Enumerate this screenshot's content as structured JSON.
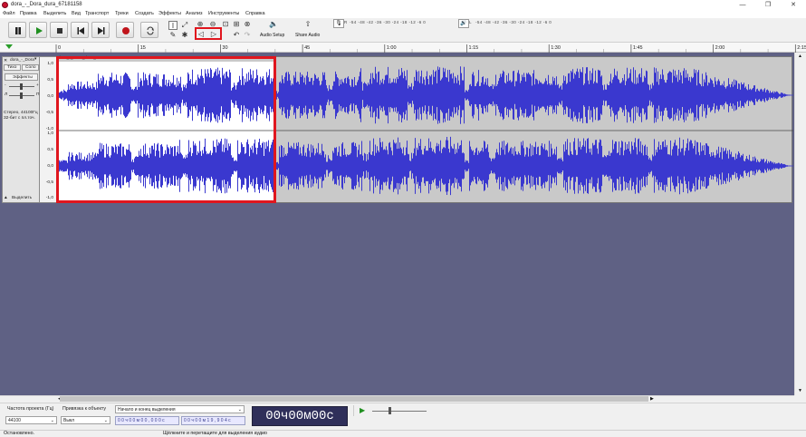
{
  "window": {
    "title": "dora_-_Dora_dura_67181158",
    "minimize": "—",
    "maximize": "❐",
    "close": "✕"
  },
  "menu": [
    "Файл",
    "Правка",
    "Выделить",
    "Вид",
    "Транспорт",
    "Треки",
    "Создать",
    "Эффекты",
    "Анализ",
    "Инструменты",
    "Справка"
  ],
  "toolbar": {
    "audio_setup": "Audio Setup",
    "share_audio": "Share Audio",
    "rec_meter_scale": "-54  -48  -42  -36  -30  -24  -18  -12  -6  0",
    "play_meter_scale": "-54  -48  -42  -36  -30  -24  -18  -12  -6  0",
    "rec_meter_letter": "R",
    "play_meter_letter": "L"
  },
  "timeline": {
    "ticks": [
      "0",
      "15",
      "30",
      "45",
      "1:00",
      "1:15",
      "1:30",
      "1:45",
      "2:00",
      "2:15"
    ]
  },
  "track": {
    "name": "dora_-_Dora",
    "mute": "Тихо",
    "solo": "Соло",
    "effects": "Эффекты",
    "gain_minus": "-",
    "gain_plus": "+",
    "pan_left": "Л",
    "pan_right": "П",
    "info_line1": "Стерео, 44100Гц",
    "info_line2": "32-бит с пл.точ.",
    "select": "Выделить",
    "clip_name": "dora_-_Dora_dura_67181158",
    "amp_labels": [
      "1,0",
      "0,5",
      "0,0",
      "-0,5",
      "-1,0"
    ]
  },
  "selection_toolbar": {
    "project_rate_label": "Частота проекта (Гц)",
    "project_rate_value": "44100",
    "snap_label": "Привязка к объекту",
    "snap_value": "Выкл",
    "selection_mode": "Начало и конец выделения",
    "sel_start": "0 0 ч 0 0 м 0 0 , 0 0 0 с",
    "sel_end": "0 0 ч 0 0 м 1 9 , 9 0 4 с"
  },
  "audio_position": "00ч00м00с",
  "status": {
    "left": "Остановлено.",
    "center": "Щёлкните и перетащите для выделения аудио"
  },
  "colors": {
    "waveform": "#3a38cf",
    "track_bg": "#5f6184",
    "highlight": "#e0161e"
  }
}
